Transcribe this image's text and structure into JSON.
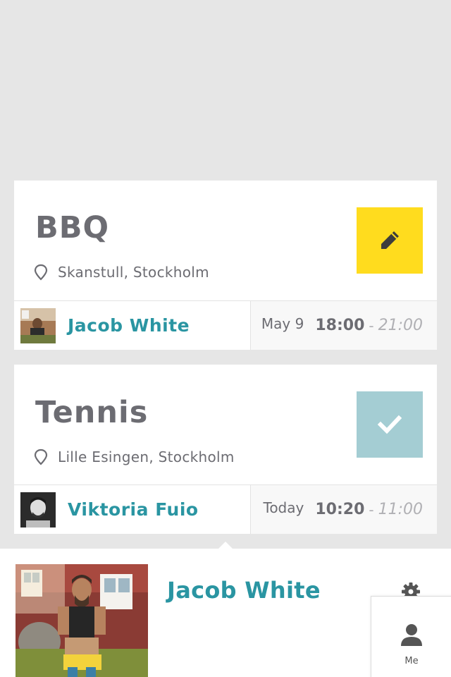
{
  "events": [
    {
      "title": "BBQ",
      "location": "Skanstull, Stockholm",
      "action": "edit-icon",
      "action_color": "#ffdc1e",
      "host": "Jacob White",
      "day": "May 9",
      "start": "18:00",
      "separator": "-",
      "end": "21:00"
    },
    {
      "title": "Tennis",
      "location": "Lille Esingen, Stockholm",
      "action": "check-icon",
      "action_color": "#a4cdd3",
      "host": "Viktoria Fuio",
      "day": "Today",
      "start": "10:20",
      "separator": "-",
      "end": "11:00"
    }
  ],
  "profile": {
    "name": "Jacob White",
    "settings_icon": "gear-icon"
  },
  "tabbar": {
    "me_label": "Me",
    "me_icon": "person-icon"
  },
  "colors": {
    "accent": "#2a95a2",
    "text": "#6c6c72",
    "muted": "#b0b0b4",
    "background": "#e6e6e6"
  }
}
